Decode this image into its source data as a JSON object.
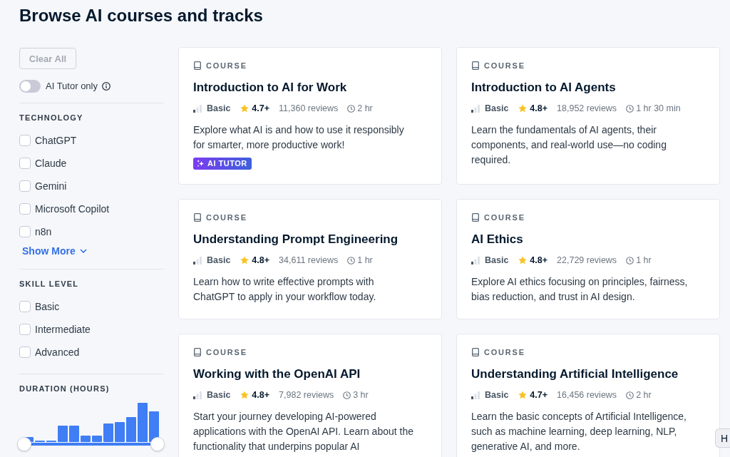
{
  "page": {
    "title": "Browse AI courses and tracks"
  },
  "filters": {
    "clear_button": {
      "label": "Clear All",
      "disabled": true
    },
    "ai_tutor_toggle": {
      "label": "AI Tutor only",
      "on": false
    },
    "sections": [
      {
        "kind": "checklist",
        "heading": "TECHNOLOGY",
        "options": [
          {
            "label": "ChatGPT",
            "checked": false
          },
          {
            "label": "Claude",
            "checked": false
          },
          {
            "label": "Gemini",
            "checked": false
          },
          {
            "label": "Microsoft Copilot",
            "checked": false
          },
          {
            "label": "n8n",
            "checked": false
          }
        ],
        "show_more": "Show More"
      },
      {
        "kind": "checklist",
        "heading": "SKILL LEVEL",
        "options": [
          {
            "label": "Basic",
            "checked": false
          },
          {
            "label": "Intermediate",
            "checked": false
          },
          {
            "label": "Advanced",
            "checked": false
          }
        ]
      },
      {
        "kind": "range",
        "heading": "DURATION (HOURS)",
        "slider": {
          "level": 1
        }
      }
    ]
  },
  "courses": [
    {
      "type": "COURSE",
      "title": "Introduction to AI for Work",
      "difficulty": "Basic",
      "rating": "4.7+",
      "reviews": "11,360 reviews",
      "duration": "2 hr",
      "description": "Explore what AI is and how to use it responsibly\nfor smarter, more productive work!",
      "badge": "AI TUTOR"
    },
    {
      "type": "COURSE",
      "title": "Introduction to AI Agents",
      "difficulty": "Basic",
      "rating": "4.8+",
      "reviews": "18,952 reviews",
      "duration": "1 hr 30 min",
      "description": "Learn the fundamentals of AI agents, their\ncomponents, and real-world use—no coding\nrequired."
    },
    {
      "type": "COURSE",
      "title": "Understanding Prompt Engineering",
      "difficulty": "Basic",
      "rating": "4.8+",
      "reviews": "34,611 reviews",
      "duration": "1 hr",
      "description": "Learn how to write effective prompts with\nChatGPT to apply in your workflow today."
    },
    {
      "type": "COURSE",
      "title": "AI Ethics",
      "difficulty": "Basic",
      "rating": "4.8+",
      "reviews": "22,729 reviews",
      "duration": "1 hr",
      "description": "Explore AI ethics focusing on principles, fairness,\nbias reduction, and trust in AI design."
    },
    {
      "type": "COURSE",
      "title": "Working with the OpenAI API",
      "difficulty": "Basic",
      "rating": "4.8+",
      "reviews": "7,982 reviews",
      "duration": "3 hr",
      "description": "Start your journey developing AI-powered\napplications with the OpenAI API. Learn about the\nfunctionality that underpins popular AI"
    },
    {
      "type": "COURSE",
      "title": "Understanding Artificial Intelligence",
      "difficulty": "Basic",
      "rating": "4.7+",
      "reviews": "16,456 reviews",
      "duration": "2 hr",
      "description": "Learn the basic concepts of Artificial Intelligence,\nsuch as machine learning, deep learning, NLP,\ngenerative AI, and more."
    }
  ],
  "help_button": {
    "label": "H"
  }
}
